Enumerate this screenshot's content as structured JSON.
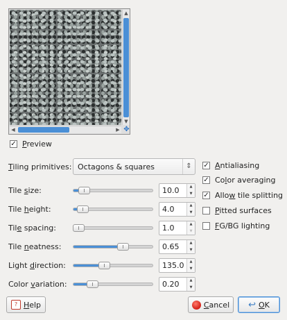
{
  "preview": {
    "label_prefix": "",
    "label_accel": "P",
    "label_rest": "review",
    "checked": true,
    "scroll_up_icon": "▲",
    "scroll_down_icon": "▼",
    "scroll_left_icon": "◀",
    "scroll_right_icon": "▶",
    "navigate_icon": "✥"
  },
  "tiling": {
    "label_prefix": "",
    "label_accel": "T",
    "label_rest": "iling primitives:",
    "value": "Octagons & squares",
    "arrow_icon": "⇕"
  },
  "sliders": [
    {
      "label_prefix": "Tile ",
      "label_accel": "s",
      "label_rest": "ize:",
      "value": "10.0",
      "fraction": 0.08
    },
    {
      "label_prefix": "Tile ",
      "label_accel": "h",
      "label_rest": "eight:",
      "value": "4.0",
      "fraction": 0.06
    },
    {
      "label_prefix": "Til",
      "label_accel": "e",
      "label_rest": " spacing:",
      "value": "1.0",
      "fraction": 0.0
    },
    {
      "label_prefix": "Tile ",
      "label_accel": "n",
      "label_rest": "eatness:",
      "value": "0.65",
      "fraction": 0.65
    },
    {
      "label_prefix": "Light ",
      "label_accel": "d",
      "label_rest": "irection:",
      "value": "135.0",
      "fraction": 0.375
    },
    {
      "label_prefix": "Color ",
      "label_accel": "v",
      "label_rest": "ariation:",
      "value": "0.20",
      "fraction": 0.2
    }
  ],
  "options": [
    {
      "label_prefix": "",
      "label_accel": "A",
      "label_rest": "ntialiasing",
      "checked": true
    },
    {
      "label_prefix": "Co",
      "label_accel": "l",
      "label_rest": "or averaging",
      "checked": true
    },
    {
      "label_prefix": "Allo",
      "label_accel": "w",
      "label_rest": " tile splitting",
      "checked": true
    },
    {
      "label_prefix": "",
      "label_accel": "P",
      "label_rest": "itted surfaces",
      "checked": false
    },
    {
      "label_prefix": "",
      "label_accel": "F",
      "label_rest": "G/BG lighting",
      "checked": false
    }
  ],
  "buttons": {
    "help": {
      "label_accel": "H",
      "label_rest": "elp"
    },
    "cancel": {
      "label_accel": "C",
      "label_rest": "ancel"
    },
    "ok": {
      "label_accel": "O",
      "label_rest": "K"
    }
  },
  "colors": {
    "accent": "#4a8fd6",
    "background": "#f1f0ee"
  }
}
